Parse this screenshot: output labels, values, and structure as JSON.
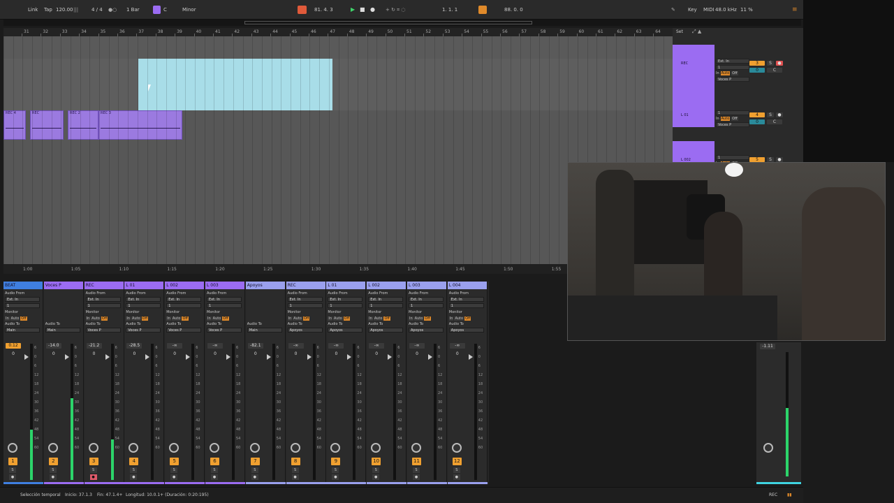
{
  "transport": {
    "link": "Link",
    "tap": "Tap",
    "tempo": "120.00",
    "signature": "4 / 4",
    "quantize": "1 Bar",
    "key": "C",
    "scale": "Minor",
    "position": "81.  4.  3",
    "loop_start": "1.  1.  1",
    "loop_length": "88.  0.  0",
    "key_label": "Key",
    "midi_label": "MIDI",
    "sample_rate": "48.0 kHz",
    "cpu": "11 %"
  },
  "ruler": {
    "bars": [
      "31",
      "32",
      "33",
      "34",
      "35",
      "36",
      "37",
      "38",
      "39",
      "40",
      "41",
      "42",
      "43",
      "44",
      "45",
      "46",
      "47",
      "48",
      "49",
      "50",
      "51",
      "52",
      "53",
      "54",
      "55",
      "56",
      "57",
      "58",
      "59",
      "60",
      "61",
      "62",
      "63",
      "64"
    ],
    "set_label": "Set"
  },
  "arrangement": {
    "clips": [
      "REC 4",
      "REC",
      "REC 2",
      "REC 3"
    ]
  },
  "time_ruler": [
    "1:00",
    "1:05",
    "1:10",
    "1:15",
    "1:20",
    "1:25",
    "1:30",
    "1:35",
    "1:40",
    "1:45",
    "1:50",
    "1:55"
  ],
  "track_headers": [
    {
      "name": "REC",
      "input": "Ext. In",
      "channel": "1",
      "out": "Voces P",
      "number": "3",
      "vol": "0",
      "pan": "C"
    },
    {
      "name": "L 01",
      "input": "",
      "channel": "1",
      "out": "Voces P",
      "number": "4",
      "vol": "0",
      "pan": "C"
    },
    {
      "name": "L 002",
      "input": "",
      "channel": "1",
      "out": "Voces P",
      "number": "5",
      "vol": "0",
      "pan": "C"
    }
  ],
  "monitor_labels": {
    "in": "In",
    "auto": "Auto",
    "off": "Off"
  },
  "mixer": {
    "audio_from": "Audio From",
    "monitor": "Monitor",
    "audio_to": "Audio To",
    "scale": [
      "6",
      "0",
      "6",
      "12",
      "18",
      "24",
      "30",
      "36",
      "42",
      "48",
      "54",
      "60"
    ],
    "strips": [
      {
        "name": "BEAT",
        "color": "#3f7fe0",
        "from": "Ext. In",
        "ch": "1",
        "to": "Main",
        "vol": "0.12",
        "pan": "0",
        "num": "1",
        "meter": 0.37
      },
      {
        "name": "Voces P",
        "color": "#9b6cf2",
        "from": "",
        "ch": "",
        "to": "Main",
        "vol": "-14.0",
        "pan": "0",
        "num": "2",
        "meter": 0.6
      },
      {
        "name": "REC",
        "color": "#9b6cf2",
        "from": "Ext. In",
        "ch": "1",
        "to": "Voces P",
        "vol": "-21.2",
        "pan": "0",
        "num": "3",
        "meter": 0.3
      },
      {
        "name": "L 01",
        "color": "#9b6cf2",
        "from": "Ext. In",
        "ch": "1",
        "to": "Voces P",
        "vol": "-28.5",
        "pan": "0",
        "num": "4",
        "meter": 0
      },
      {
        "name": "L 002",
        "color": "#9b6cf2",
        "from": "Ext. In",
        "ch": "1",
        "to": "Voces P",
        "vol": "-∞",
        "pan": "0",
        "num": "5",
        "meter": 0
      },
      {
        "name": "L 003",
        "color": "#9b6cf2",
        "from": "Ext. In",
        "ch": "1",
        "to": "Voces P",
        "vol": "-∞",
        "pan": "0",
        "num": "6",
        "meter": 0
      },
      {
        "name": "Apoyos",
        "color": "#9aa0ee",
        "from": "",
        "ch": "",
        "to": "Main",
        "vol": "-82.1",
        "pan": "0",
        "num": "7",
        "meter": 0
      },
      {
        "name": "REC",
        "color": "#9aa0ee",
        "from": "Ext. In",
        "ch": "1",
        "to": "Apoyos",
        "vol": "-∞",
        "pan": "0",
        "num": "8",
        "meter": 0
      },
      {
        "name": "L 01",
        "color": "#9aa0ee",
        "from": "Ext. In",
        "ch": "1",
        "to": "Apoyos",
        "vol": "-∞",
        "pan": "0",
        "num": "9",
        "meter": 0
      },
      {
        "name": "L 002",
        "color": "#9aa0ee",
        "from": "Ext. In",
        "ch": "1",
        "to": "Apoyos",
        "vol": "-∞",
        "pan": "0",
        "num": "10",
        "meter": 0
      },
      {
        "name": "L 003",
        "color": "#9aa0ee",
        "from": "Ext. In",
        "ch": "1",
        "to": "Apoyos",
        "vol": "-∞",
        "pan": "0",
        "num": "11",
        "meter": 0
      },
      {
        "name": "L 004",
        "color": "#9aa0ee",
        "from": "Ext. In",
        "ch": "1",
        "to": "Apoyos",
        "vol": "-∞",
        "pan": "0",
        "num": "12",
        "meter": 0
      }
    ]
  },
  "master": {
    "vol": "-1.11",
    "pan": "0",
    "meter": 0.55
  },
  "status": {
    "mode": "Selección temporal",
    "start": "Inicio: 37.1.3",
    "end": "Fin: 47.1.4+",
    "length": "Longitud: 10.0.1+ (Duración: 0:20:195)",
    "rec": "REC"
  },
  "colors": {
    "purple": "#9b6cf2",
    "blue": "#3f7fe0",
    "orange": "#f0a030",
    "selection": "#a8dde8",
    "lavender": "#9aa0ee"
  }
}
